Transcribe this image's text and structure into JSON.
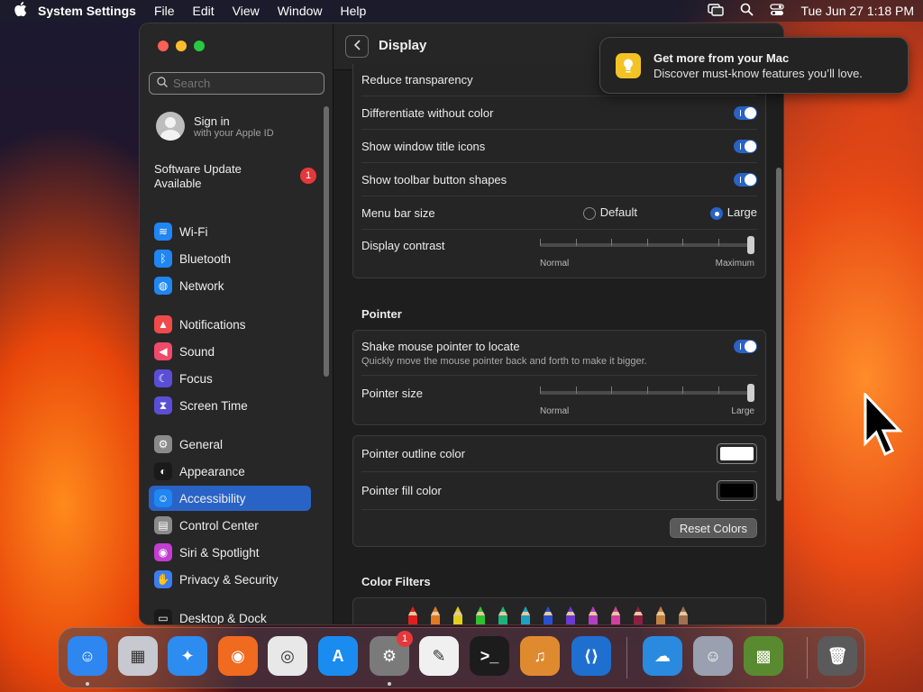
{
  "menubar": {
    "app": "System Settings",
    "items": [
      "File",
      "Edit",
      "View",
      "Window",
      "Help"
    ],
    "datetime": "Tue Jun 27  1:18 PM"
  },
  "sidebar": {
    "search_placeholder": "Search",
    "signin_title": "Sign in",
    "signin_sub": "with your Apple ID",
    "software_update": "Software Update Available",
    "software_update_badge": "1",
    "items": [
      {
        "label": "Wi-Fi",
        "color": "#1f86f2",
        "glyph": "≋"
      },
      {
        "label": "Bluetooth",
        "color": "#1f86f2",
        "glyph": "ᛒ"
      },
      {
        "label": "Network",
        "color": "#1f86f2",
        "glyph": "◍"
      },
      {
        "label": "Notifications",
        "color": "#f04a4a",
        "glyph": "▲"
      },
      {
        "label": "Sound",
        "color": "#f04a6a",
        "glyph": "◀"
      },
      {
        "label": "Focus",
        "color": "#5b4ed6",
        "glyph": "☾"
      },
      {
        "label": "Screen Time",
        "color": "#5b4ed6",
        "glyph": "⧗"
      },
      {
        "label": "General",
        "color": "#8a8a8a",
        "glyph": "⚙"
      },
      {
        "label": "Appearance",
        "color": "#1a1a1a",
        "glyph": "◐"
      },
      {
        "label": "Accessibility",
        "color": "#1f86f2",
        "glyph": "☺"
      },
      {
        "label": "Control Center",
        "color": "#8a8a8a",
        "glyph": "▤"
      },
      {
        "label": "Siri & Spotlight",
        "color": "#c03ed0",
        "glyph": "◉"
      },
      {
        "label": "Privacy & Security",
        "color": "#3b7ef0",
        "glyph": "✋"
      },
      {
        "label": "Desktop & Dock",
        "color": "#1a1a1a",
        "glyph": "▭"
      }
    ]
  },
  "display": {
    "title": "Display",
    "rows": {
      "reduce_transparency": "Reduce transparency",
      "differentiate": "Differentiate without color",
      "window_title_icons": "Show window title icons",
      "toolbar_shapes": "Show toolbar button shapes",
      "menu_bar_size": "Menu bar size",
      "menu_default": "Default",
      "menu_large": "Large",
      "contrast": "Display contrast",
      "contrast_min": "Normal",
      "contrast_max": "Maximum"
    },
    "contrast_level": 1.0
  },
  "pointer": {
    "section": "Pointer",
    "shake": "Shake mouse pointer to locate",
    "shake_sub": "Quickly move the mouse pointer back and forth to make it bigger.",
    "size": "Pointer size",
    "size_min": "Normal",
    "size_max": "Large",
    "size_level": 1.0,
    "outline": "Pointer outline color",
    "outline_color": "#ffffff",
    "fill": "Pointer fill color",
    "fill_color": "#000000",
    "reset": "Reset Colors"
  },
  "color_filters": {
    "section": "Color Filters",
    "pencils": [
      "#e02020",
      "#e07a20",
      "#e0d020",
      "#30c030",
      "#20b07a",
      "#20a0c0",
      "#2a50d0",
      "#6a3ad0",
      "#b040c0",
      "#d040a0",
      "#8a2040",
      "#c08040",
      "#a07050"
    ]
  },
  "notification": {
    "title": "Get more from your Mac",
    "body": "Discover must-know features you’ll love."
  },
  "dock": {
    "apps": [
      {
        "name": "finder-icon",
        "color": "#2e86f0",
        "glyph": "☺"
      },
      {
        "name": "launchpad-icon",
        "color": "#c8c8d0",
        "glyph": "▦"
      },
      {
        "name": "safari-icon",
        "color": "#2d8cf0",
        "glyph": "✦"
      },
      {
        "name": "firefox-icon",
        "color": "#f06a20",
        "glyph": "◉"
      },
      {
        "name": "chrome-icon",
        "color": "#e8e8e8",
        "glyph": "◎"
      },
      {
        "name": "app-store-icon",
        "color": "#1a8cf0",
        "glyph": "A"
      },
      {
        "name": "system-settings-icon",
        "color": "#7a7a7a",
        "glyph": "⚙",
        "badge": "1"
      },
      {
        "name": "textedit-icon",
        "color": "#f0f0f0",
        "glyph": "✎"
      },
      {
        "name": "terminal-icon",
        "color": "#1c1c1c",
        "glyph": ">_"
      },
      {
        "name": "garageband-icon",
        "color": "#e08a30",
        "glyph": "♫"
      },
      {
        "name": "vscode-icon",
        "color": "#1f6fd0",
        "glyph": "⟨⟩"
      },
      {
        "name": "weather-icon",
        "color": "#2a8ae0",
        "glyph": "☁"
      },
      {
        "name": "finder-alt-icon",
        "color": "#9aa0b0",
        "glyph": "☺"
      },
      {
        "name": "minecraft-icon",
        "color": "#5a8a30",
        "glyph": "▩"
      },
      {
        "name": "trash-icon",
        "color": "#5a5a5a",
        "glyph": "🗑"
      }
    ]
  }
}
